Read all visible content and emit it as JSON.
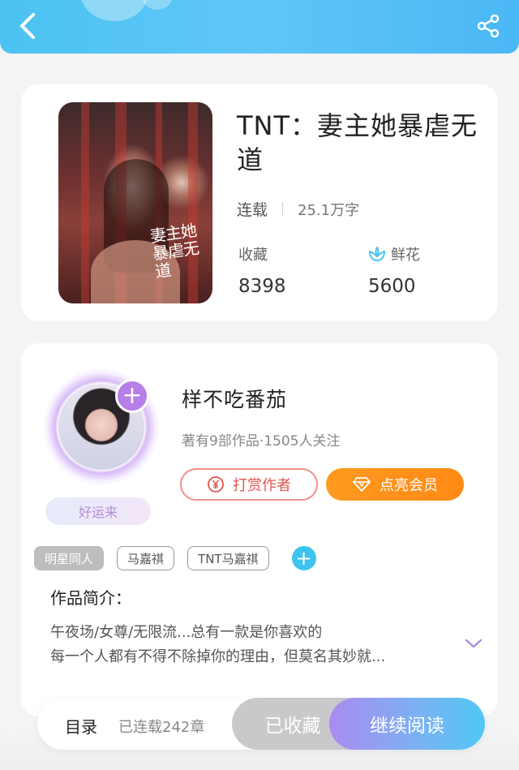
{
  "header": {
    "back_icon": "back-chevron-icon",
    "share_icon": "share-icon",
    "accent_color": "#4cc3f2"
  },
  "book": {
    "title": "TNT：妻主她暴虐无道",
    "cover_title": "妻主她暴虐无道",
    "status": "连载",
    "word_count": "25.1万字",
    "collect_label": "收藏",
    "collect_value": "8398",
    "flower_label": "鲜花",
    "flower_value": "5600"
  },
  "author": {
    "name": "样不吃番茄",
    "sub": "著有9部作品·1505人关注",
    "lucky_badge": "好运来",
    "reward_label": "打赏作者",
    "vip_label": "点亮会员"
  },
  "tags": [
    "明星同人",
    "马嘉祺",
    "TNT马嘉祺"
  ],
  "intro": {
    "title": "作品简介：",
    "line1": "午夜场/女尊/无限流...总有一款是你喜欢的",
    "line2": "每一个人都有不得不除掉你的理由，但莫名其妙就..."
  },
  "bottom": {
    "toc_label": "目录",
    "toc_count": "已连载242章",
    "collected_label": "已收藏",
    "read_label": "继续阅读"
  }
}
